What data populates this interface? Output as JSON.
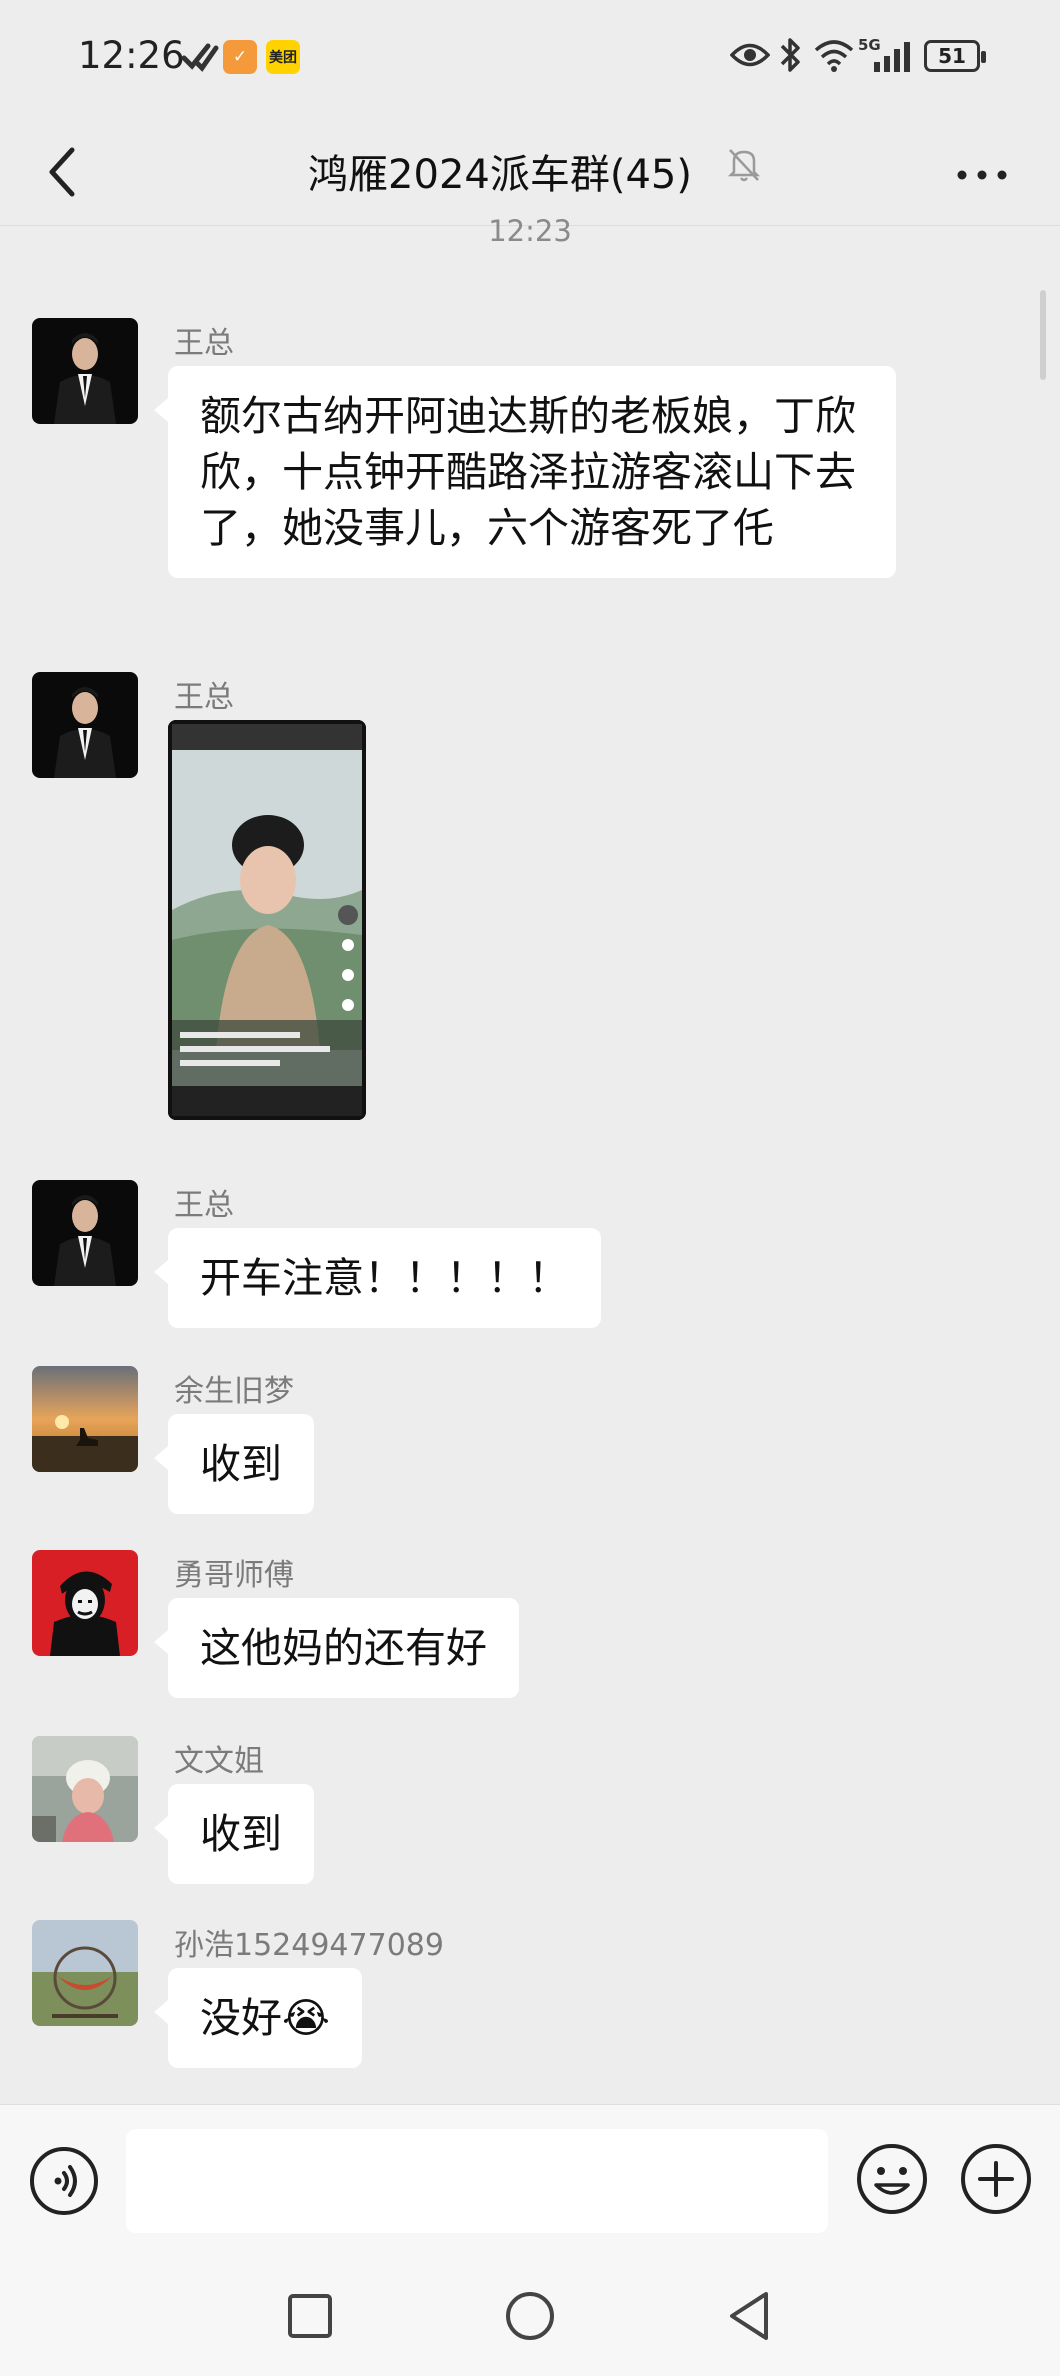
{
  "status_bar": {
    "time": "12:26",
    "app_badge_1": "✓",
    "app_badge_2": "美团",
    "network": "5G",
    "battery": "51"
  },
  "header": {
    "title": "鸿雁2024派车群(45)"
  },
  "chat": {
    "timestamp": "12:23",
    "messages": [
      {
        "sender": "王总",
        "type": "text",
        "text": "额尔古纳开阿迪达斯的老板娘，丁欣欣，十点钟开酷路泽拉游客滚山下去了，她没事儿，六个游客死了仛"
      },
      {
        "sender": "王总",
        "type": "image"
      },
      {
        "sender": "王总",
        "type": "text",
        "text": "开车注意！！！！！"
      },
      {
        "sender": "余生旧梦",
        "type": "text",
        "text": "收到"
      },
      {
        "sender": "勇哥师傅",
        "type": "text",
        "text": "这他妈的还有好"
      },
      {
        "sender": "文文姐",
        "type": "text",
        "text": "收到"
      },
      {
        "sender": "孙浩15249477089",
        "type": "text",
        "text": "没好😭"
      }
    ]
  },
  "input_bar": {
    "value": ""
  },
  "colors": {
    "background": "#ededed",
    "bubble": "#ffffff",
    "sender_name": "#7b7b7b"
  }
}
